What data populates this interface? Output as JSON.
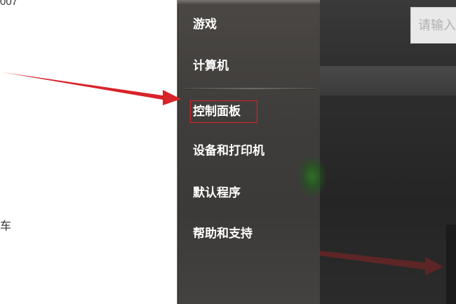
{
  "left_document": {
    "top_fragment": "007",
    "middle_fragment": "车"
  },
  "start_menu": {
    "items": [
      {
        "label": "游戏"
      },
      {
        "label": "计算机"
      },
      {
        "label": "控制面板"
      },
      {
        "label": "设备和打印机"
      },
      {
        "label": "默认程序"
      },
      {
        "label": "帮助和支持"
      }
    ],
    "highlighted_item": "控制面板"
  },
  "search": {
    "placeholder": "请输入"
  },
  "annotations": {
    "arrow_color": "#d8232a",
    "highlight_color": "#d8232a"
  }
}
